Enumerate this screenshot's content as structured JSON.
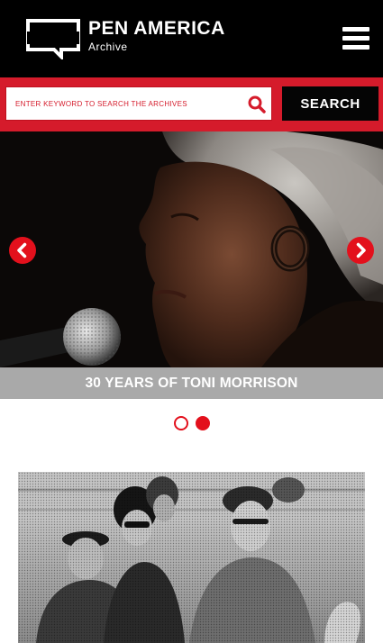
{
  "header": {
    "logo_title": "PEN AMERICA",
    "logo_subtitle": "Archive",
    "menu_icon": "hamburger-menu-icon"
  },
  "search": {
    "placeholder": "ENTER KEYWORD TO SEARCH THE ARCHIVES",
    "value": "",
    "button_label": "SEARCH",
    "icon": "search-icon"
  },
  "slider": {
    "caption": "30 YEARS OF TONI MORRISON",
    "prev_icon": "chevron-left-icon",
    "next_icon": "chevron-right-icon",
    "slide_count": 2,
    "active_index": 2
  },
  "colors": {
    "brand_red": "#d51b2b",
    "header_black": "#000000",
    "caption_gray": "#a9a9a9"
  }
}
